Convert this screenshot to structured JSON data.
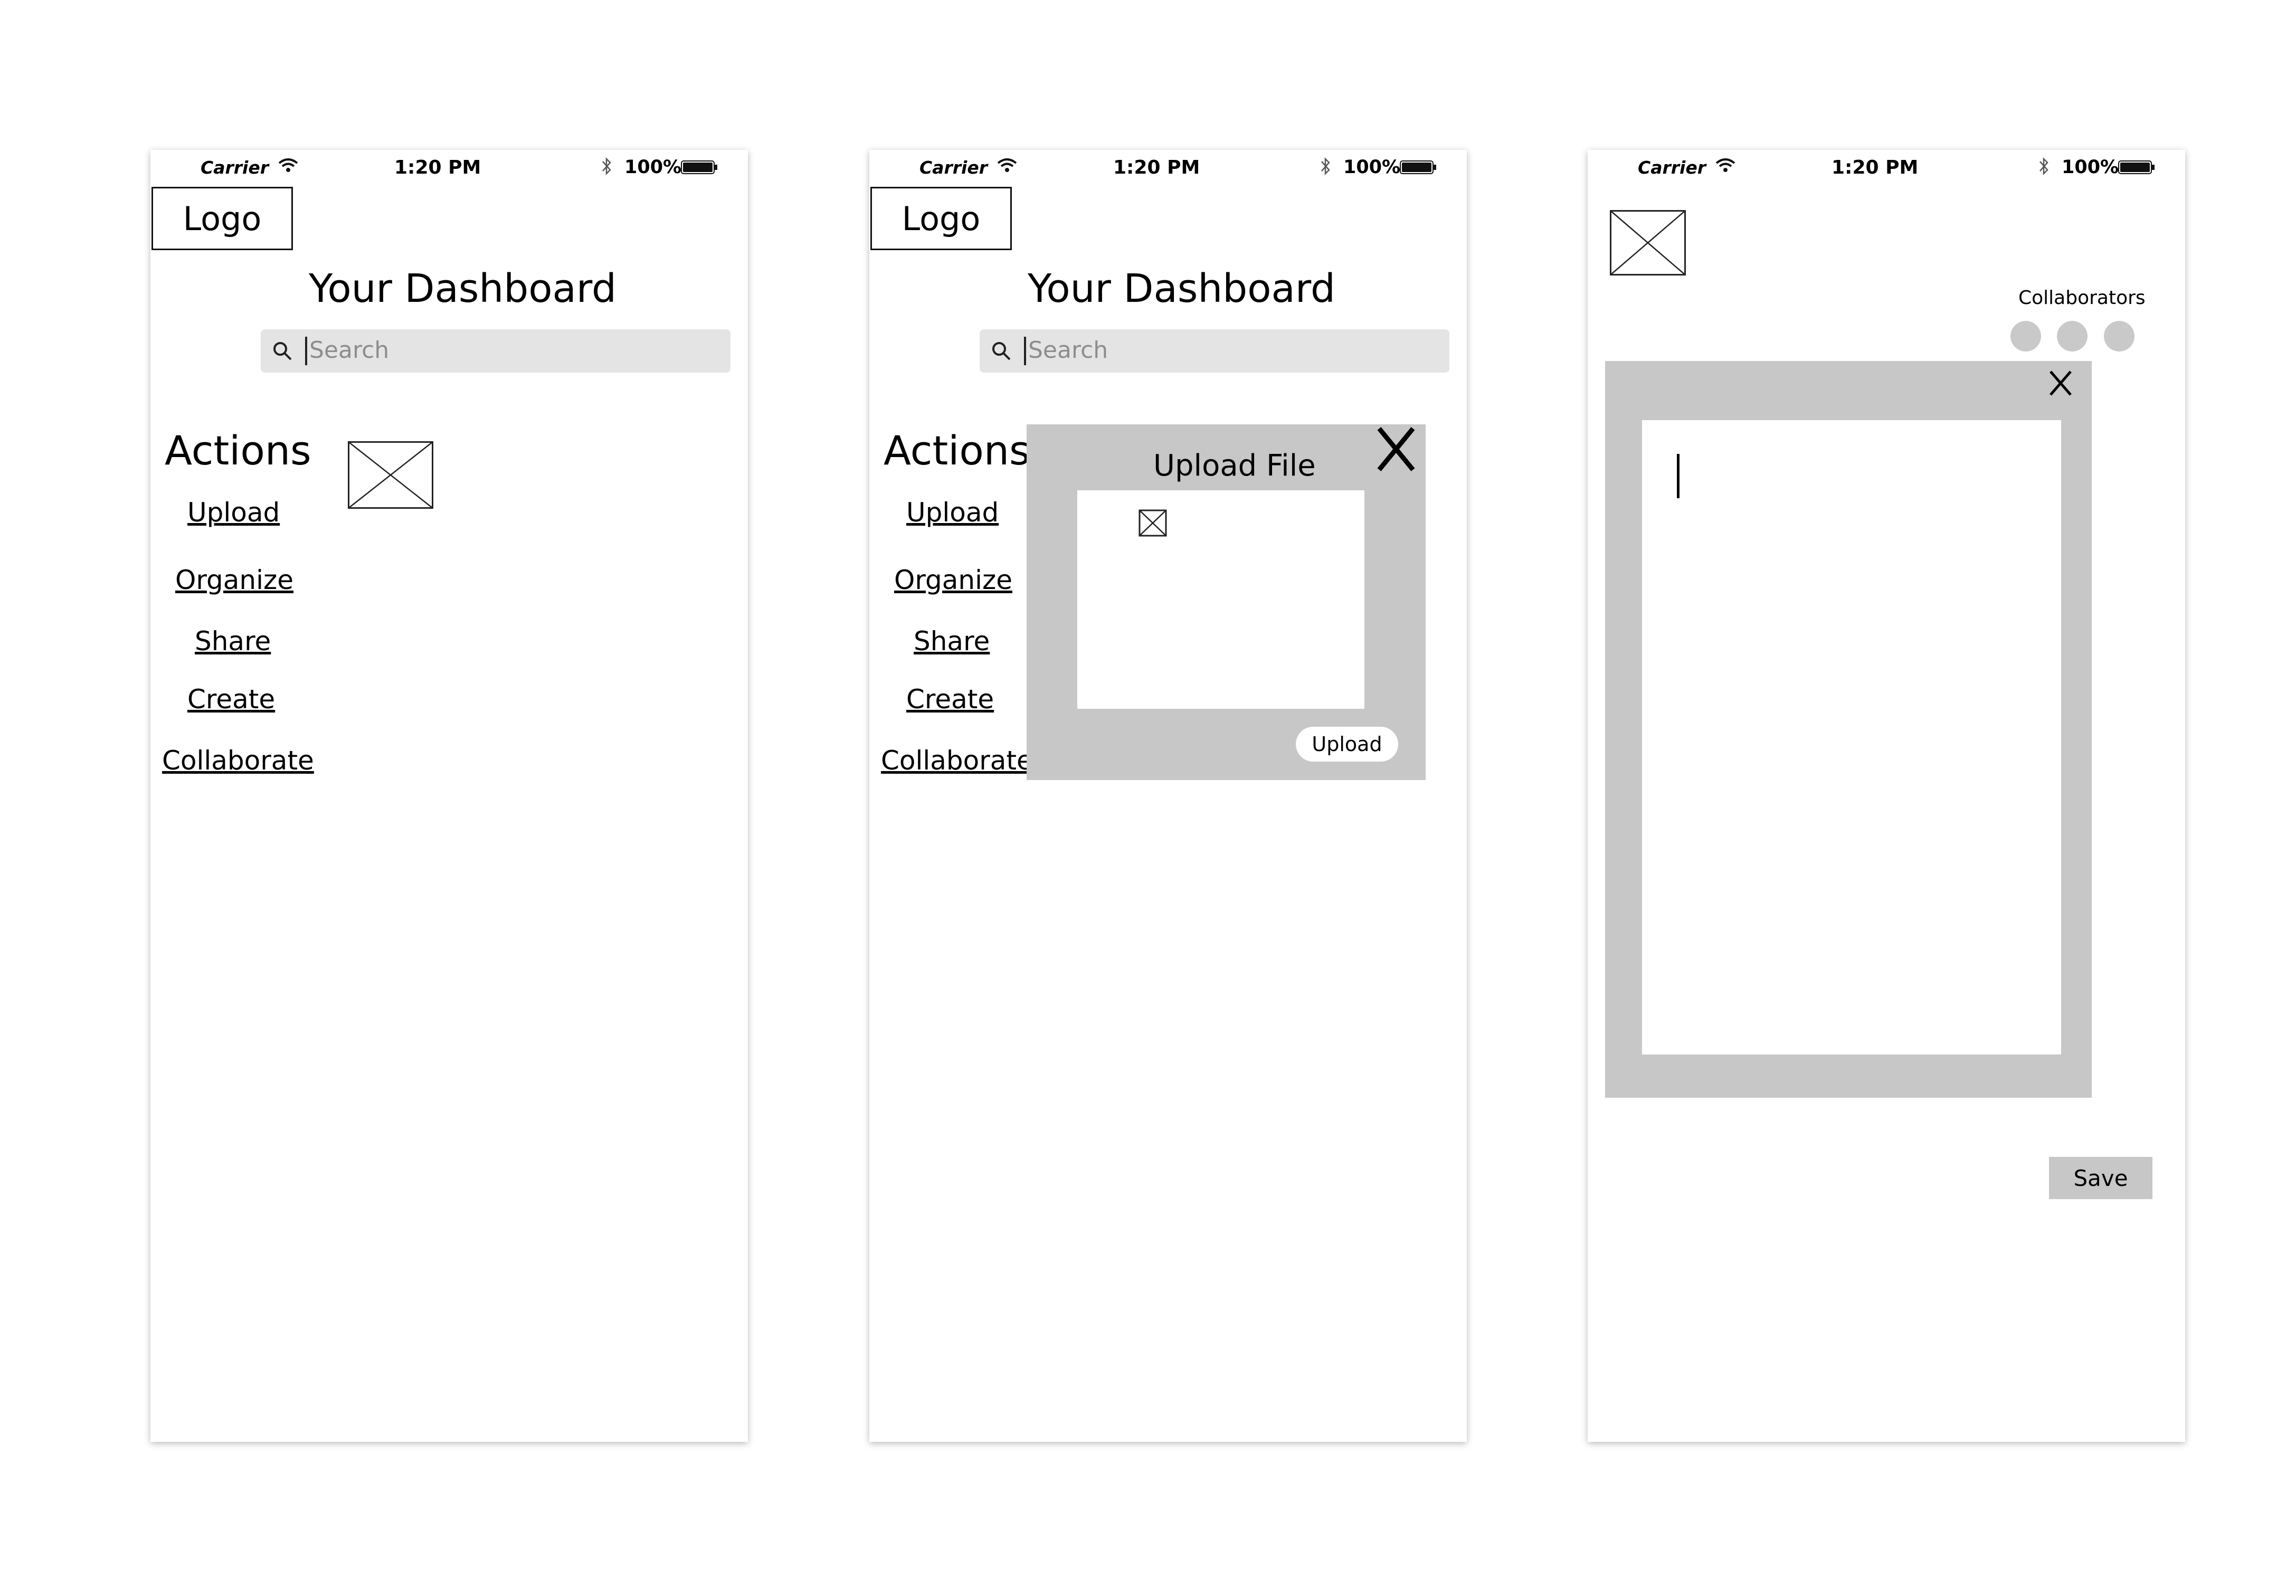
{
  "status_bar": {
    "carrier": "Carrier",
    "time": "1:20 PM",
    "battery": "100%"
  },
  "dashboard": {
    "logo": "Logo",
    "title": "Your Dashboard",
    "search_placeholder": "Search",
    "actions_heading": "Actions",
    "actions": [
      "Upload",
      "Organize",
      "Share",
      "Create",
      "Collaborate"
    ]
  },
  "upload_modal": {
    "title": "Upload File",
    "close": "X",
    "upload_button": "Upload"
  },
  "editor": {
    "collaborators_label": "Collaborators",
    "collaborator_count": 3,
    "close": "X",
    "save_button": "Save"
  },
  "colors": {
    "panel_gray": "#c7c7c7",
    "search_bg": "#e4e4e4",
    "placeholder_text": "#8d8d8d"
  },
  "icons": [
    "wifi-icon",
    "bluetooth-icon",
    "battery-icon",
    "search-icon",
    "image-placeholder-icon",
    "close-icon"
  ]
}
